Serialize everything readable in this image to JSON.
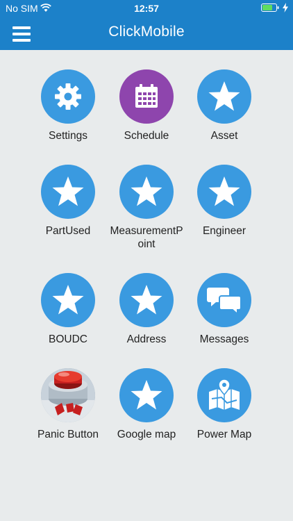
{
  "status": {
    "carrier": "No SIM",
    "time": "12:57"
  },
  "header": {
    "title": "ClickMobile"
  },
  "tiles": [
    {
      "label": "Settings",
      "icon": "gear-icon"
    },
    {
      "label": "Schedule",
      "icon": "calendar-icon"
    },
    {
      "label": "Asset",
      "icon": "star-icon"
    },
    {
      "label": "PartUsed",
      "icon": "star-icon"
    },
    {
      "label": "MeasurementPoint",
      "icon": "star-icon"
    },
    {
      "label": "Engineer",
      "icon": "star-icon"
    },
    {
      "label": "BOUDC",
      "icon": "star-icon"
    },
    {
      "label": "Address",
      "icon": "star-icon"
    },
    {
      "label": "Messages",
      "icon": "chat-bubbles-icon"
    },
    {
      "label": "Panic Button",
      "icon": "sos-button-icon"
    },
    {
      "label": "Google map",
      "icon": "star-icon"
    },
    {
      "label": "Power Map",
      "icon": "map-pin-icon"
    }
  ],
  "colors": {
    "header": "#1c81c9",
    "tile_blue": "#3a9ae0",
    "tile_purple": "#8e45ad",
    "background": "#e8ebec"
  }
}
